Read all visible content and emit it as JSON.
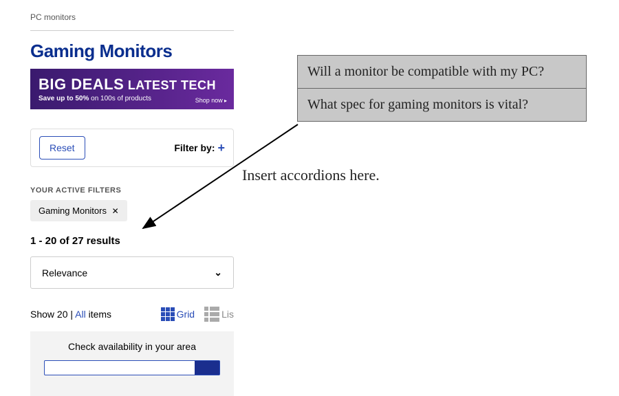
{
  "breadcrumb": "PC monitors",
  "page_title": "Gaming Monitors",
  "promo": {
    "big": "BIG DEALS",
    "latest": "LATEST TECH",
    "sub_bold": "Save up to 50%",
    "sub_rest": " on 100s of products",
    "shop": "Shop now"
  },
  "filter": {
    "reset": "Reset",
    "filter_by": "Filter by:"
  },
  "active_filters": {
    "label": "YOUR ACTIVE FILTERS",
    "tag": "Gaming Monitors",
    "tag_close": "✕"
  },
  "results_count": "1 - 20 of 27 results",
  "sort": {
    "value": "Relevance"
  },
  "show": {
    "prefix": "Show ",
    "count": "20",
    "sep": " | ",
    "all": "All",
    "suffix": " items",
    "grid": "Grid",
    "list": "Lis"
  },
  "availability": {
    "label": "Check availability in your area"
  },
  "accordions": [
    "Will a monitor be compatible with my PC?",
    "What spec for gaming monitors is vital?"
  ],
  "annotation": "Insert accordions here."
}
